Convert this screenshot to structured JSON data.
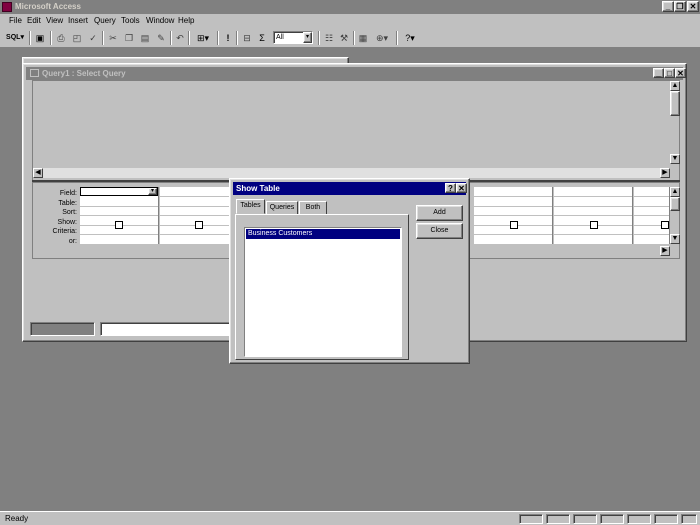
{
  "app": {
    "title": "Microsoft Access"
  },
  "menu": [
    "File",
    "Edit",
    "View",
    "Insert",
    "Query",
    "Tools",
    "Window",
    "Help"
  ],
  "toolbar": {
    "sql_label": "SQL",
    "top_values": "All"
  },
  "query_window": {
    "title": "Query1 : Select Query",
    "row_labels": [
      "Field:",
      "Table:",
      "Sort:",
      "Show:",
      "Criteria:",
      "or:"
    ]
  },
  "show_table": {
    "title": "Show Table",
    "tabs": [
      "Tables",
      "Queries",
      "Both"
    ],
    "items": [
      "Business Customers"
    ],
    "add_label": "Add",
    "close_label": "Close",
    "help_glyph": "?",
    "close_glyph": "✕"
  },
  "status": {
    "text": "Ready"
  }
}
